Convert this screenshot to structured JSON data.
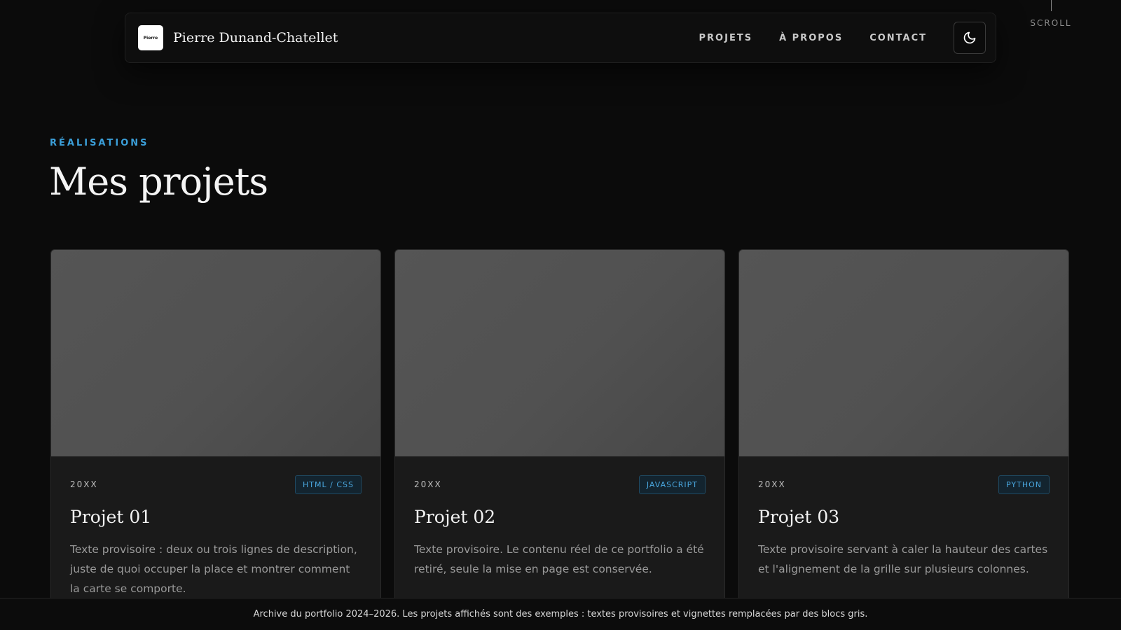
{
  "scroll": {
    "label": "SCROLL"
  },
  "navbar": {
    "logo_text": "Pierre",
    "brand_name": "Pierre Dunand-Chatellet",
    "links": [
      {
        "label": "PROJETS"
      },
      {
        "label": "À PROPOS"
      },
      {
        "label": "CONTACT"
      }
    ],
    "theme_toggle_icon": "moon-icon"
  },
  "section": {
    "eyebrow": "RÉALISATIONS",
    "title": "Mes projets"
  },
  "projects": [
    {
      "year": "20XX",
      "tag": "HTML / CSS",
      "title": "Projet 01",
      "description": "Texte provisoire : deux ou trois lignes de description, juste de quoi occuper la place et montrer comment la carte se comporte."
    },
    {
      "year": "20XX",
      "tag": "JAVASCRIPT",
      "title": "Projet 02",
      "description": "Texte provisoire. Le contenu réel de ce portfolio a été retiré, seule la mise en page est conservée."
    },
    {
      "year": "20XX",
      "tag": "PYTHON",
      "title": "Projet 03",
      "description": "Texte provisoire servant à caler la hauteur des cartes et l'alignement de la grille sur plusieurs colonnes."
    }
  ],
  "footer": {
    "text": "Archive du portfolio 2024–2026. Les projets affichés sont des exemples : textes provisoires et vignettes remplacées par des blocs gris."
  },
  "colors": {
    "background": "#0b0b0b",
    "accent": "#3b9fd9",
    "card": "#1a1a1a",
    "thumbnail": "#525252"
  }
}
